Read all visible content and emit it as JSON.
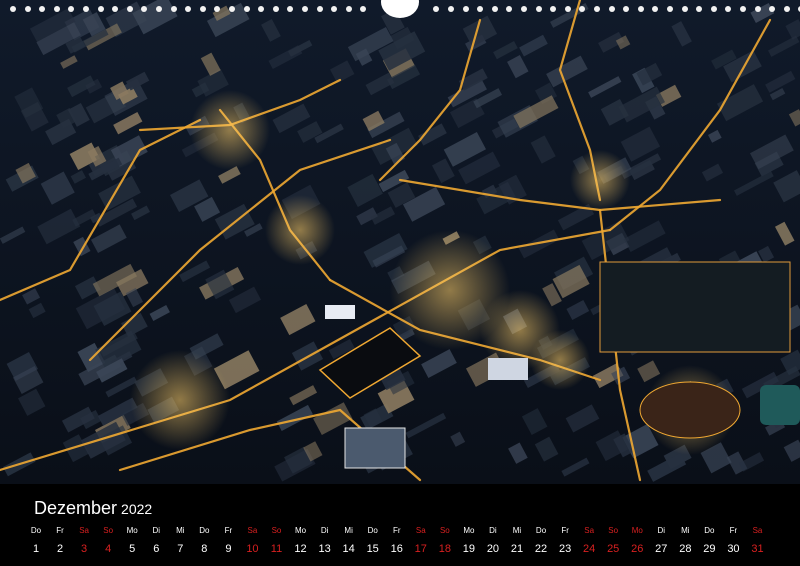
{
  "calendar": {
    "month": "Dezember",
    "year": "2022",
    "weekend_color": "#d82020",
    "days": [
      {
        "dn": "Do",
        "d": "1",
        "we": false
      },
      {
        "dn": "Fr",
        "d": "2",
        "we": false
      },
      {
        "dn": "Sa",
        "d": "3",
        "we": true
      },
      {
        "dn": "So",
        "d": "4",
        "we": true
      },
      {
        "dn": "Mo",
        "d": "5",
        "we": false
      },
      {
        "dn": "Di",
        "d": "6",
        "we": false
      },
      {
        "dn": "Mi",
        "d": "7",
        "we": false
      },
      {
        "dn": "Do",
        "d": "8",
        "we": false
      },
      {
        "dn": "Fr",
        "d": "9",
        "we": false
      },
      {
        "dn": "Sa",
        "d": "10",
        "we": true
      },
      {
        "dn": "So",
        "d": "11",
        "we": true
      },
      {
        "dn": "Mo",
        "d": "12",
        "we": false
      },
      {
        "dn": "Di",
        "d": "13",
        "we": false
      },
      {
        "dn": "Mi",
        "d": "14",
        "we": false
      },
      {
        "dn": "Do",
        "d": "15",
        "we": false
      },
      {
        "dn": "Fr",
        "d": "16",
        "we": false
      },
      {
        "dn": "Sa",
        "d": "17",
        "we": true
      },
      {
        "dn": "So",
        "d": "18",
        "we": true
      },
      {
        "dn": "Mo",
        "d": "19",
        "we": false
      },
      {
        "dn": "Di",
        "d": "20",
        "we": false
      },
      {
        "dn": "Mi",
        "d": "21",
        "we": false
      },
      {
        "dn": "Do",
        "d": "22",
        "we": false
      },
      {
        "dn": "Fr",
        "d": "23",
        "we": false
      },
      {
        "dn": "Sa",
        "d": "24",
        "we": true
      },
      {
        "dn": "So",
        "d": "25",
        "we": true
      },
      {
        "dn": "Mo",
        "d": "26",
        "we": true
      },
      {
        "dn": "Di",
        "d": "27",
        "we": false
      },
      {
        "dn": "Mi",
        "d": "28",
        "we": false
      },
      {
        "dn": "Do",
        "d": "29",
        "we": false
      },
      {
        "dn": "Fr",
        "d": "30",
        "we": false
      },
      {
        "dn": "Sa",
        "d": "31",
        "we": true
      }
    ]
  },
  "photo": {
    "subject": "aerial-night-city",
    "background_color": "#0d1420",
    "street_light_color": "#f0a832",
    "building_color": "#26303f"
  }
}
